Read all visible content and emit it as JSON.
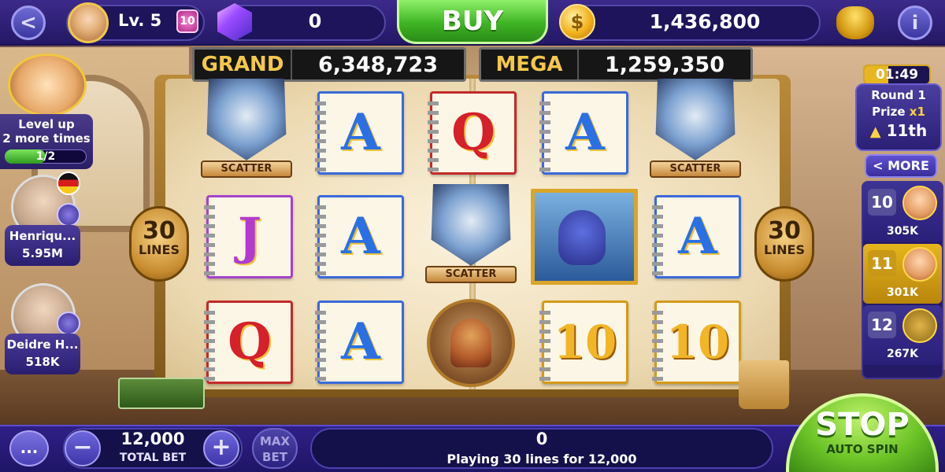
{
  "topbar": {
    "level_label": "Lv. 5",
    "level_badge": "10",
    "gem_count": "0",
    "buy_label": "BUY",
    "coin_symbol": "$",
    "coin_balance": "1,436,800",
    "back_icon": "chevron-left-icon",
    "info_icon": "info-icon",
    "info_label": "i"
  },
  "jackpots": [
    {
      "label": "GRAND",
      "value": "6,348,723"
    },
    {
      "label": "MEGA",
      "value": "1,259,350"
    }
  ],
  "paylines": {
    "count": "30",
    "label": "LINES"
  },
  "reels": {
    "rows": [
      [
        "SCATTER",
        "A",
        "Q",
        "A",
        "SCATTER"
      ],
      [
        "J",
        "A",
        "SCATTER",
        "MONSTER",
        "A"
      ],
      [
        "Q",
        "A",
        "BRUTE",
        "10",
        "10"
      ]
    ],
    "scatter_label": "SCATTER"
  },
  "level_up": {
    "line1": "Level up",
    "line2": "2 more times",
    "progress": "1/2",
    "progress_fraction": 0.5
  },
  "friends": [
    {
      "name": "Henriqu...",
      "coins": "5.95M"
    },
    {
      "name": "Deidre H...",
      "coins": "518K"
    }
  ],
  "tournament": {
    "timer": "01:49",
    "round": "Round 1",
    "prize_label": "Prize",
    "prize_mult": "x1",
    "rank": "11th",
    "more_label": "< MORE",
    "leaderboard": [
      {
        "rank": "10",
        "coins": "305K"
      },
      {
        "rank": "11",
        "coins": "301K"
      },
      {
        "rank": "12",
        "coins": "267K"
      }
    ]
  },
  "bottom": {
    "chat_label": "...",
    "minus_label": "−",
    "plus_label": "+",
    "total_bet": "12,000",
    "total_bet_label": "TOTAL BET",
    "max_bet_line1": "MAX",
    "max_bet_line2": "BET",
    "win_amount": "0",
    "playing_caption": "Playing 30 lines for 12,000",
    "stop_label": "STOP",
    "autospin_label": "AUTO SPIN"
  },
  "colors": {
    "accent_purple": "#2f1f86",
    "buy_green": "#3fb524",
    "jackpot_gold": "#f5c84a"
  }
}
